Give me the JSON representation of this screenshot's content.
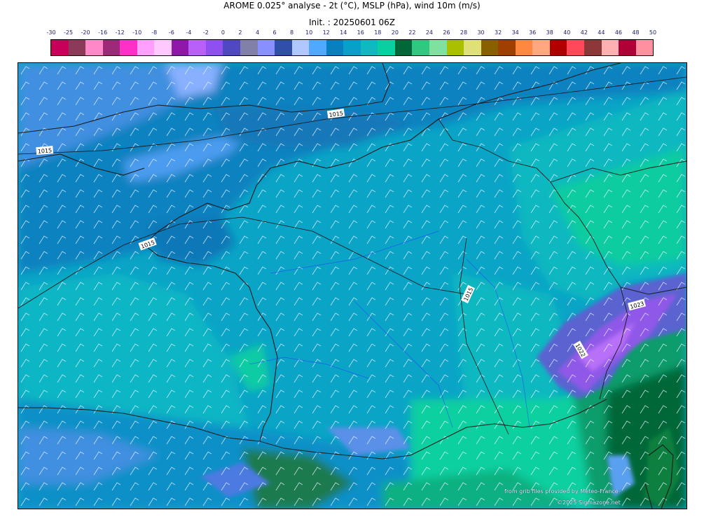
{
  "header": {
    "title": "AROME 0.025° analyse - 2t (°C), MSLP (hPa), wind 10m (m/s)",
    "init": "Init. : 20250601 06Z"
  },
  "colorbar": {
    "ticks": [
      "-30",
      "-25",
      "-20",
      "-16",
      "-12",
      "-10",
      "-8",
      "-6",
      "-4",
      "-2",
      "0",
      "2",
      "4",
      "6",
      "8",
      "10",
      "12",
      "14",
      "16",
      "18",
      "20",
      "22",
      "24",
      "26",
      "28",
      "30",
      "32",
      "34",
      "36",
      "38",
      "40",
      "42",
      "44",
      "46",
      "48",
      "50"
    ],
    "colors": [
      "#c8005a",
      "#8b3a5a",
      "#ff88c8",
      "#9c2a78",
      "#ff30c8",
      "#ffa0ff",
      "#ffc8ff",
      "#9018a8",
      "#b860f8",
      "#9050f0",
      "#5048c0",
      "#8080a8",
      "#8890ff",
      "#3050a8",
      "#b0c8ff",
      "#50a8ff",
      "#0880c0",
      "#08a0c8",
      "#10b8c0",
      "#08d0a0",
      "#006838",
      "#30c880",
      "#80e0a0",
      "#a8c000",
      "#e0e078",
      "#886000",
      "#a04000",
      "#ff8840",
      "#ffa880",
      "#b00000",
      "#ff4858",
      "#8c3838",
      "#ffb0b0",
      "#b00038",
      "#ff90a0"
    ]
  },
  "map": {
    "isobar_labels": [
      "1015",
      "1015",
      "1015",
      "1015",
      "1023",
      "1022"
    ],
    "credit_line1": "from grib files provided by Meteo-France",
    "credit_line2": "©2025 Sigmazone.net"
  }
}
